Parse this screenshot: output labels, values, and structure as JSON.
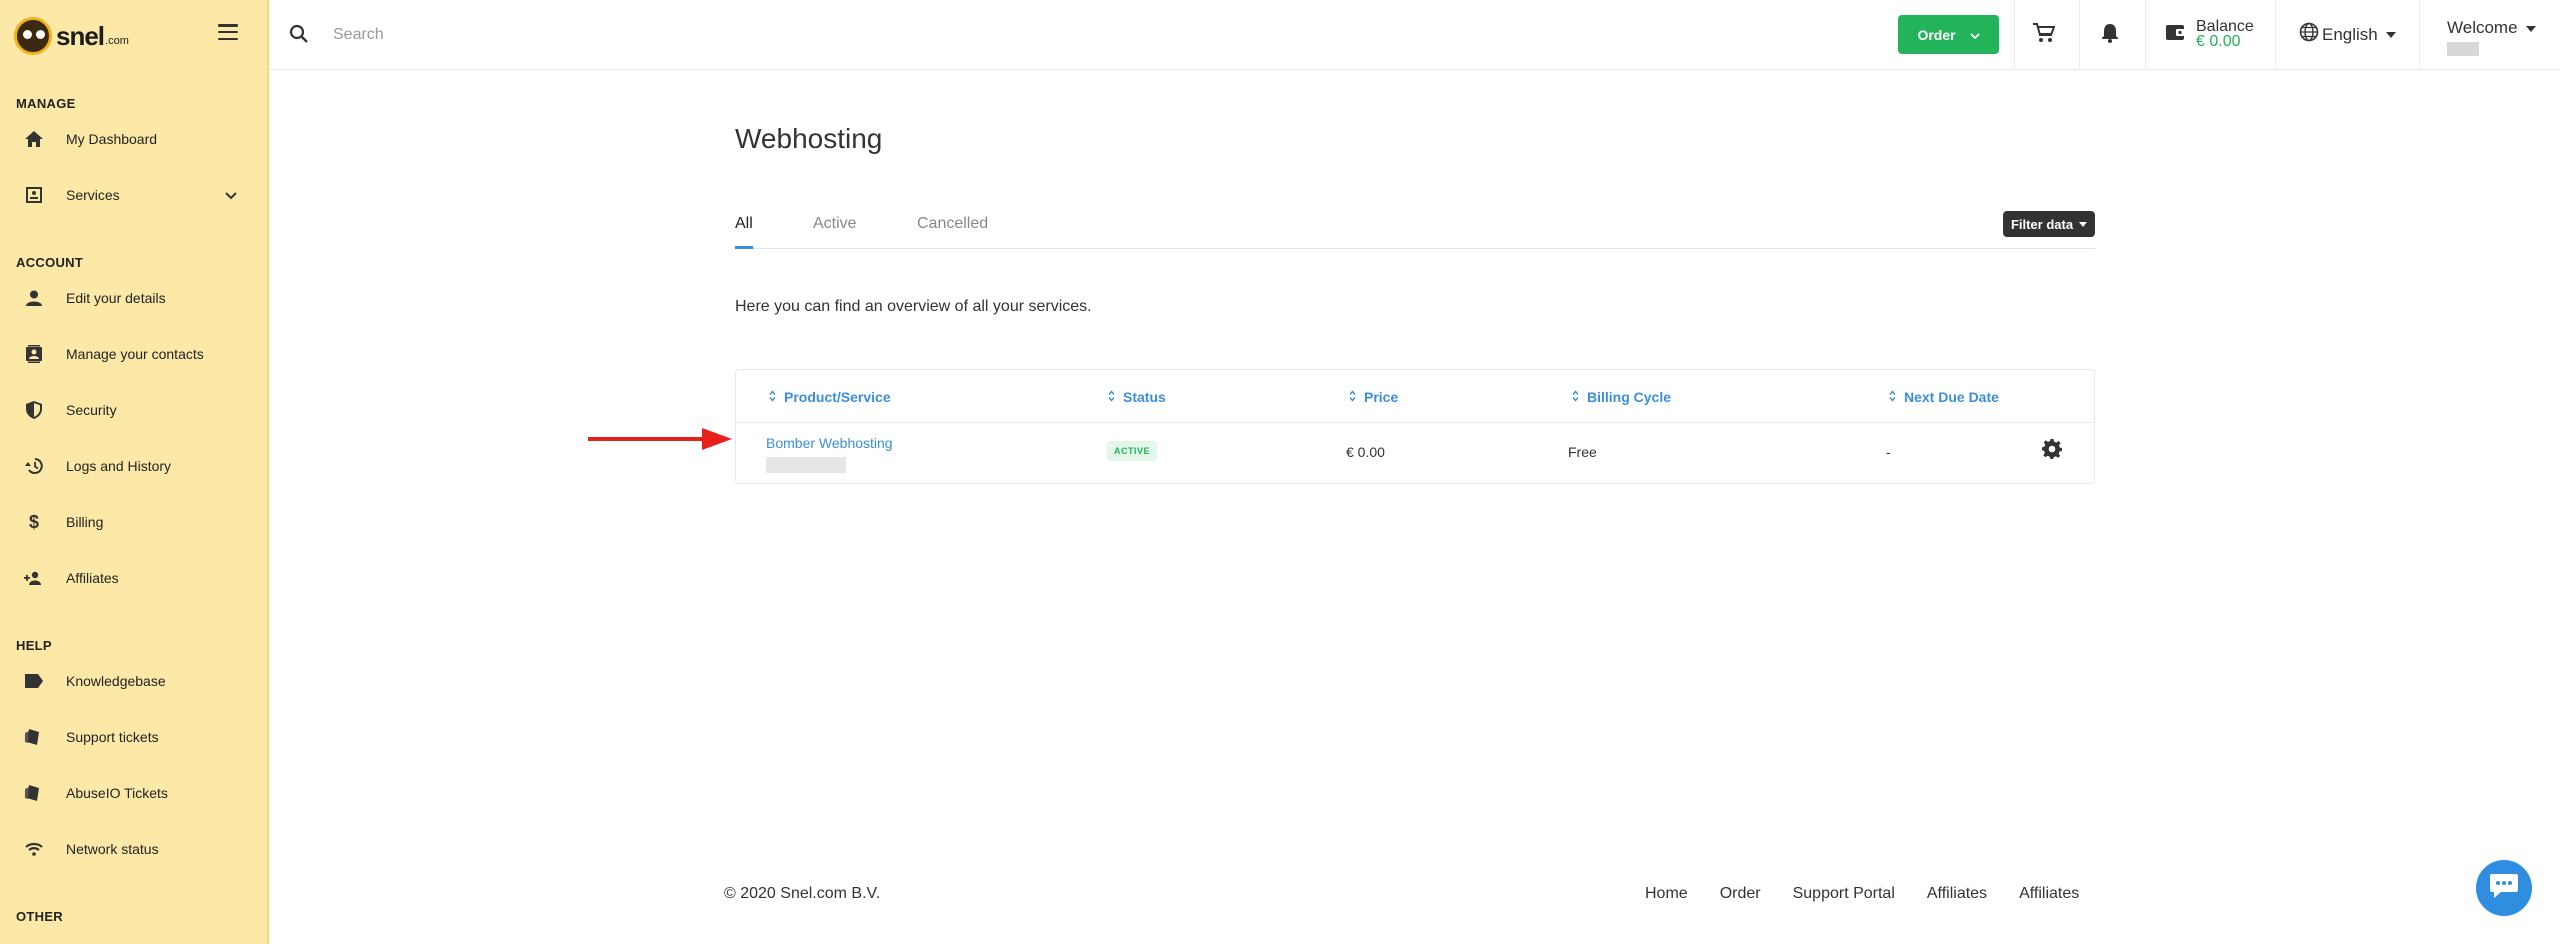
{
  "brand": {
    "name": "snel",
    "suffix": ".com"
  },
  "sidebar": {
    "sections": [
      {
        "title": "MANAGE",
        "items": [
          {
            "label": "My Dashboard",
            "icon": "home-icon"
          },
          {
            "label": "Services",
            "icon": "services-icon"
          }
        ]
      },
      {
        "title": "ACCOUNT",
        "items": [
          {
            "label": "Edit your details",
            "icon": "person-icon"
          },
          {
            "label": "Manage your contacts",
            "icon": "contacts-icon"
          },
          {
            "label": "Security",
            "icon": "shield-icon"
          },
          {
            "label": "Logs and History",
            "icon": "history-icon"
          },
          {
            "label": "Billing",
            "icon": "dollar-icon"
          },
          {
            "label": "Affiliates",
            "icon": "affiliates-icon"
          }
        ]
      },
      {
        "title": "HELP",
        "items": [
          {
            "label": "Knowledgebase",
            "icon": "label-icon"
          },
          {
            "label": "Support tickets",
            "icon": "ticket-icon"
          },
          {
            "label": "AbuseIO Tickets",
            "icon": "ticket-icon"
          },
          {
            "label": "Network status",
            "icon": "wifi-icon"
          }
        ]
      },
      {
        "title": "OTHER",
        "items": []
      }
    ]
  },
  "topbar": {
    "search_placeholder": "Search",
    "order_label": "Order",
    "balance_label": "Balance",
    "balance_value": "€ 0.00",
    "language": "English",
    "welcome": "Welcome"
  },
  "main": {
    "title": "Webhosting",
    "tabs": [
      {
        "label": "All",
        "active": true
      },
      {
        "label": "Active",
        "active": false
      },
      {
        "label": "Cancelled",
        "active": false
      }
    ],
    "filter_label": "Filter data",
    "intro": "Here you can find an overview of all your services.",
    "table": {
      "columns": [
        "Product/Service",
        "Status",
        "Price",
        "Billing Cycle",
        "Next Due Date"
      ],
      "rows": [
        {
          "product": "Bomber Webhosting",
          "status": "ACTIVE",
          "price": "€ 0.00",
          "billing_cycle": "Free",
          "next_due": "-"
        }
      ]
    }
  },
  "footer": {
    "copyright": "© 2020 Snel.com B.V.",
    "links": [
      "Home",
      "Order",
      "Support Portal",
      "Affiliates",
      "Affiliates"
    ]
  },
  "colors": {
    "sidebar_bg": "#fde9a7",
    "accent": "#3b8fd9",
    "success": "#22b35b",
    "annotation": "#e8201c"
  }
}
